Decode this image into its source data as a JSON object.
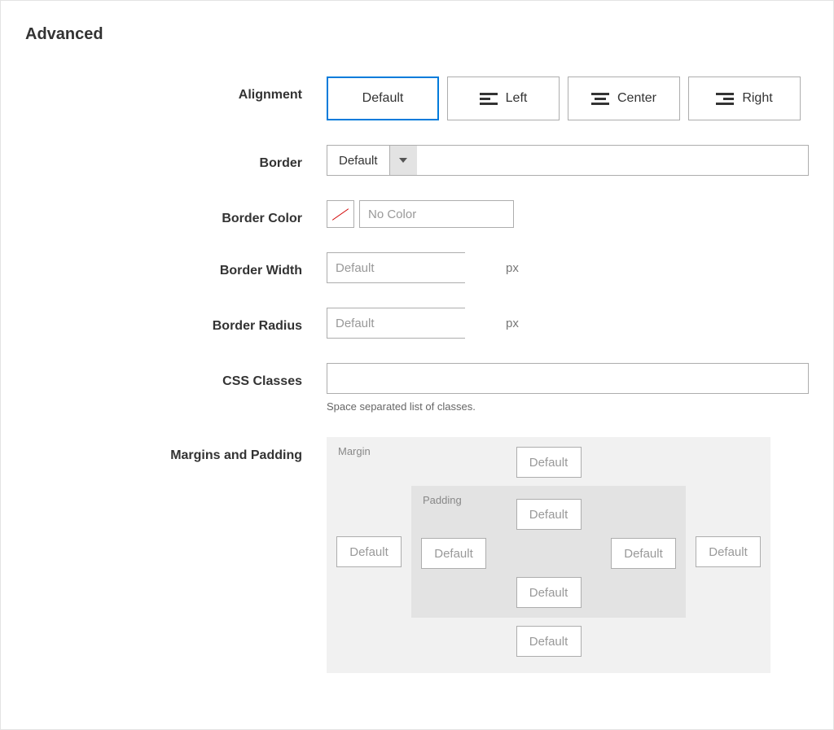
{
  "section_title": "Advanced",
  "alignment": {
    "label": "Alignment",
    "default_label": "Default",
    "left_label": "Left",
    "center_label": "Center",
    "right_label": "Right",
    "selected": "default"
  },
  "border": {
    "label": "Border",
    "value": "Default"
  },
  "border_color": {
    "label": "Border Color",
    "placeholder": "No Color",
    "value": ""
  },
  "border_width": {
    "label": "Border Width",
    "placeholder": "Default",
    "unit": "px",
    "value": ""
  },
  "border_radius": {
    "label": "Border Radius",
    "placeholder": "Default",
    "unit": "px",
    "value": ""
  },
  "css_classes": {
    "label": "CSS Classes",
    "value": "",
    "hint": "Space separated list of classes."
  },
  "margins_padding": {
    "label": "Margins and Padding",
    "margin_label": "Margin",
    "padding_label": "Padding",
    "placeholder": "Default",
    "margin": {
      "top": "",
      "right": "",
      "bottom": "",
      "left": ""
    },
    "padding": {
      "top": "",
      "right": "",
      "bottom": "",
      "left": ""
    }
  }
}
